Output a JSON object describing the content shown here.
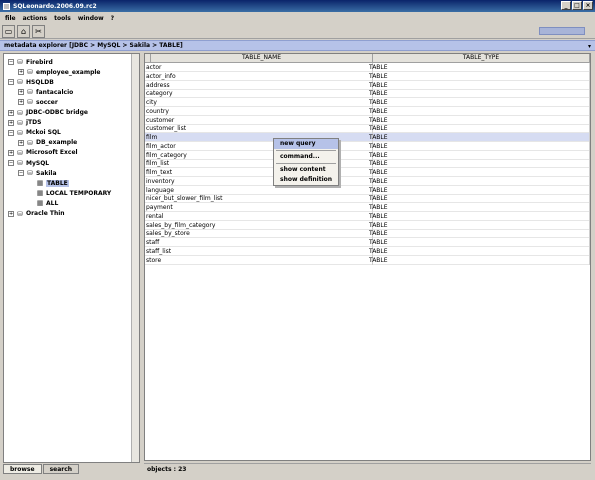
{
  "window": {
    "title": "SQLeonardo.2006.09.rc2",
    "buttons": [
      "_",
      "□",
      "×"
    ]
  },
  "menu": [
    "file",
    "actions",
    "tools",
    "window",
    "?"
  ],
  "toolbar": {
    "buttons": [
      {
        "name": "new-document-icon",
        "glyph": "▭"
      },
      {
        "name": "home-icon",
        "glyph": "⌂"
      },
      {
        "name": "tools-icon",
        "glyph": "✂"
      }
    ]
  },
  "pathbar": {
    "path": "metadata explorer [JDBC > MySQL > Sakila > TABLE]",
    "collapse": "▾"
  },
  "tree": [
    {
      "label": "Firebird",
      "level": 0,
      "expander": "−"
    },
    {
      "label": "employee_example",
      "level": 1,
      "expander": "+"
    },
    {
      "label": "HSQLDB",
      "level": 0,
      "expander": "−"
    },
    {
      "label": "fantacalcio",
      "level": 1,
      "expander": "+"
    },
    {
      "label": "soccer",
      "level": 1,
      "expander": "+"
    },
    {
      "label": "JDBC-ODBC bridge",
      "level": 0,
      "expander": "+"
    },
    {
      "label": "jTDS",
      "level": 0,
      "expander": "+"
    },
    {
      "label": "Mckoi SQL",
      "level": 0,
      "expander": "−"
    },
    {
      "label": "DB_example",
      "level": 1,
      "expander": "+"
    },
    {
      "label": "Microsoft Excel",
      "level": 0,
      "expander": "+"
    },
    {
      "label": "MySQL",
      "level": 0,
      "expander": "−"
    },
    {
      "label": "Sakila",
      "level": 1,
      "expander": "−"
    },
    {
      "label": "TABLE",
      "level": 2,
      "expander": "",
      "selected": true
    },
    {
      "label": "LOCAL TEMPORARY",
      "level": 2,
      "expander": ""
    },
    {
      "label": "ALL",
      "level": 2,
      "expander": ""
    },
    {
      "label": "Oracle Thin",
      "level": 0,
      "expander": "+"
    }
  ],
  "left_tabs": [
    "browse",
    "search"
  ],
  "table": {
    "columns": [
      "TABLE_NAME",
      "TABLE_TYPE"
    ],
    "rows": [
      [
        "actor",
        "TABLE"
      ],
      [
        "actor_info",
        "TABLE"
      ],
      [
        "address",
        "TABLE"
      ],
      [
        "category",
        "TABLE"
      ],
      [
        "city",
        "TABLE"
      ],
      [
        "country",
        "TABLE"
      ],
      [
        "customer",
        "TABLE"
      ],
      [
        "customer_list",
        "TABLE"
      ],
      [
        "film",
        "TABLE"
      ],
      [
        "film_actor",
        "TABLE"
      ],
      [
        "film_category",
        "TABLE"
      ],
      [
        "film_list",
        "TABLE"
      ],
      [
        "film_text",
        "TABLE"
      ],
      [
        "inventory",
        "TABLE"
      ],
      [
        "language",
        "TABLE"
      ],
      [
        "nicer_but_slower_film_list",
        "TABLE"
      ],
      [
        "payment",
        "TABLE"
      ],
      [
        "rental",
        "TABLE"
      ],
      [
        "sales_by_film_category",
        "TABLE"
      ],
      [
        "sales_by_store",
        "TABLE"
      ],
      [
        "staff",
        "TABLE"
      ],
      [
        "staff_list",
        "TABLE"
      ],
      [
        "store",
        "TABLE"
      ]
    ],
    "highlighted_row": "film"
  },
  "context_menu": [
    "new query",
    "command...",
    "show content",
    "show definition"
  ],
  "status": "objects : 23"
}
